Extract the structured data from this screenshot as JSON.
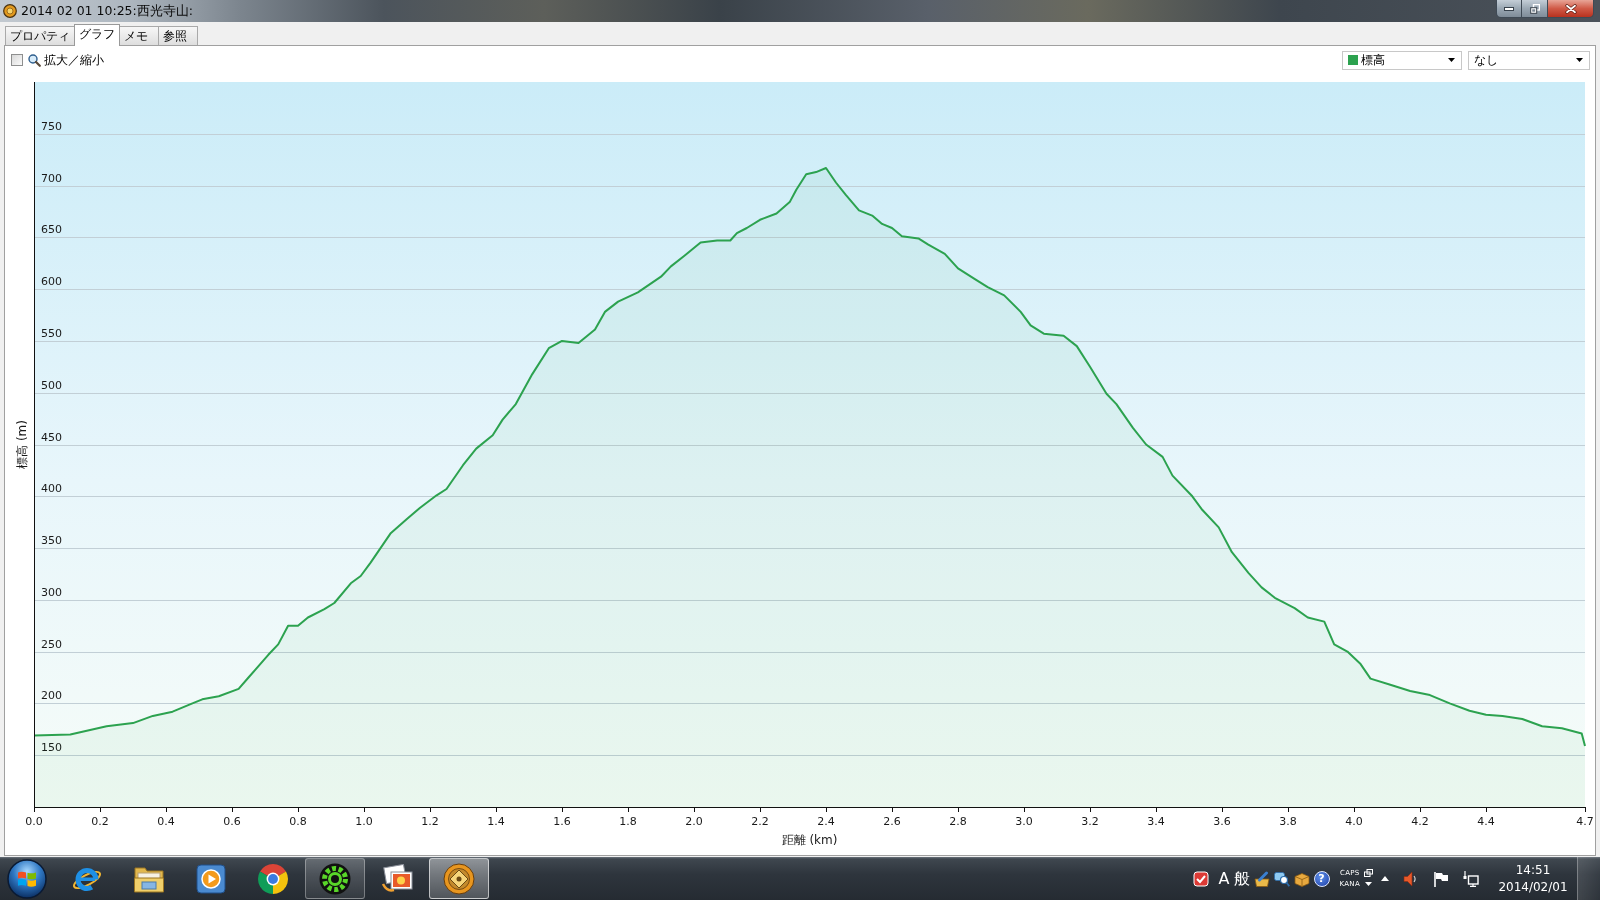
{
  "window": {
    "title": "2014 02 01 10:25:西光寺山:"
  },
  "tabs": [
    {
      "label": "プロパティ",
      "selected": false
    },
    {
      "label": "グラフ",
      "selected": true
    },
    {
      "label": "メモ",
      "selected": false
    },
    {
      "label": "参照",
      "selected": false
    }
  ],
  "toolbar": {
    "zoom": {
      "label": "拡大／縮小",
      "checked": false
    },
    "series_select": {
      "value": "標高"
    },
    "compare_select": {
      "value": "なし"
    }
  },
  "chart": {
    "chart_data": {
      "type": "area",
      "xlabel": "距離 (km)",
      "ylabel": "標高 (m)",
      "x": [
        0,
        0.11,
        0.22,
        0.3,
        0.36,
        0.42,
        0.48,
        0.51,
        0.56,
        0.62,
        0.65,
        0.71,
        0.74,
        0.77,
        0.8,
        0.83,
        0.88,
        0.91,
        0.96,
        0.99,
        1.02,
        1.08,
        1.13,
        1.17,
        1.22,
        1.25,
        1.3,
        1.34,
        1.39,
        1.42,
        1.46,
        1.51,
        1.56,
        1.6,
        1.65,
        1.7,
        1.73,
        1.77,
        1.83,
        1.9,
        1.93,
        1.97,
        2.02,
        2.07,
        2.11,
        2.13,
        2.16,
        2.2,
        2.25,
        2.29,
        2.31,
        2.34,
        2.37,
        2.4,
        2.43,
        2.46,
        2.5,
        2.54,
        2.57,
        2.6,
        2.63,
        2.68,
        2.71,
        2.76,
        2.8,
        2.85,
        2.89,
        2.94,
        2.99,
        3.02,
        3.06,
        3.12,
        3.16,
        3.2,
        3.25,
        3.28,
        3.33,
        3.37,
        3.42,
        3.45,
        3.51,
        3.54,
        3.59,
        3.63,
        3.68,
        3.72,
        3.76,
        3.82,
        3.86,
        3.91,
        3.94,
        3.98,
        4.02,
        4.05,
        4.11,
        4.17,
        4.23,
        4.29,
        4.35,
        4.4,
        4.45,
        4.51,
        4.57,
        4.63,
        4.69,
        4.7
      ],
      "series": [
        {
          "color": "#2ca24f",
          "values": [
            169,
            170,
            178,
            181,
            188,
            192,
            200,
            204,
            207,
            214,
            225,
            247,
            257,
            275,
            275,
            283,
            291,
            297,
            316,
            323,
            336,
            364,
            378,
            389,
            401,
            407,
            430,
            446,
            459,
            474,
            489,
            518,
            543,
            550,
            548,
            561,
            578,
            588,
            597,
            612,
            622,
            632,
            645,
            647,
            647,
            654,
            659,
            667,
            673,
            684,
            696,
            711,
            713,
            717,
            703,
            691,
            676,
            671,
            663,
            659,
            651,
            649,
            643,
            634,
            620,
            610,
            602,
            594,
            578,
            565,
            557,
            555,
            545,
            525,
            499,
            489,
            466,
            450,
            438,
            420,
            400,
            387,
            370,
            346,
            326,
            312,
            302,
            292,
            283,
            279,
            257,
            250,
            238,
            224,
            218,
            212,
            208,
            200,
            193,
            189,
            188,
            185,
            178,
            176,
            171,
            159
          ]
        }
      ],
      "xlim": [
        0,
        4.7
      ],
      "ylim": [
        100,
        800
      ],
      "xticks": [
        {
          "value": 0,
          "label": "0.0"
        },
        0.2,
        0.4,
        0.6,
        0.8,
        {
          "value": 1,
          "label": "1.0"
        },
        1.2,
        1.4,
        1.6,
        1.8,
        {
          "value": 2,
          "label": "2.0"
        },
        2.2,
        2.4,
        2.6,
        2.8,
        {
          "value": 3,
          "label": "3.0"
        },
        3.2,
        3.4,
        3.6,
        3.8,
        {
          "value": 4,
          "label": "4.0"
        },
        4.2,
        4.4,
        4.7
      ],
      "yticks": [
        150,
        200,
        250,
        300,
        350,
        400,
        450,
        500,
        550,
        600,
        650,
        700,
        750
      ],
      "grid": true
    }
  },
  "taskbar": {
    "apps": [
      {
        "kind": "ie",
        "running": false,
        "selected": false
      },
      {
        "kind": "folder",
        "running": false,
        "selected": false
      },
      {
        "kind": "media",
        "running": false,
        "selected": false
      },
      {
        "kind": "chrome",
        "running": false,
        "selected": false
      },
      {
        "kind": "gear",
        "running": true,
        "selected": false
      },
      {
        "kind": "photos",
        "running": false,
        "selected": false
      },
      {
        "kind": "compass",
        "running": true,
        "selected": true
      }
    ],
    "ime": {
      "mode": "A",
      "dictionary": "般",
      "caps": "CAPS",
      "kana": "KANA"
    },
    "help": "?",
    "clock": {
      "time": "14:51",
      "date": "2014/02/01"
    }
  }
}
